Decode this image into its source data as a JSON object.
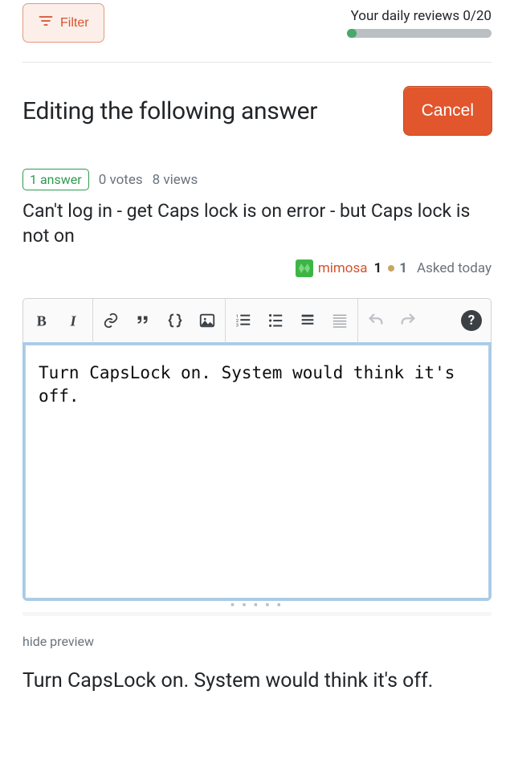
{
  "top": {
    "filter_label": "Filter",
    "reviews_label": "Your daily reviews 0/20",
    "reviews_current": 0,
    "reviews_max": 20
  },
  "heading": "Editing the following answer",
  "cancel_label": "Cancel",
  "stats": {
    "answer_pill": "1 answer",
    "votes": "0 votes",
    "views": "8 views"
  },
  "question_title": "Can't log in - get Caps lock is on error - but Caps lock is not on",
  "asker": {
    "name": "mimosa",
    "rep": "1",
    "bronze": "1",
    "asked": "Asked today"
  },
  "editor": {
    "content": "Turn CapsLock on. System would think it's off."
  },
  "hide_preview_label": "hide preview",
  "preview_text": "Turn CapsLock on. System would think it's off."
}
